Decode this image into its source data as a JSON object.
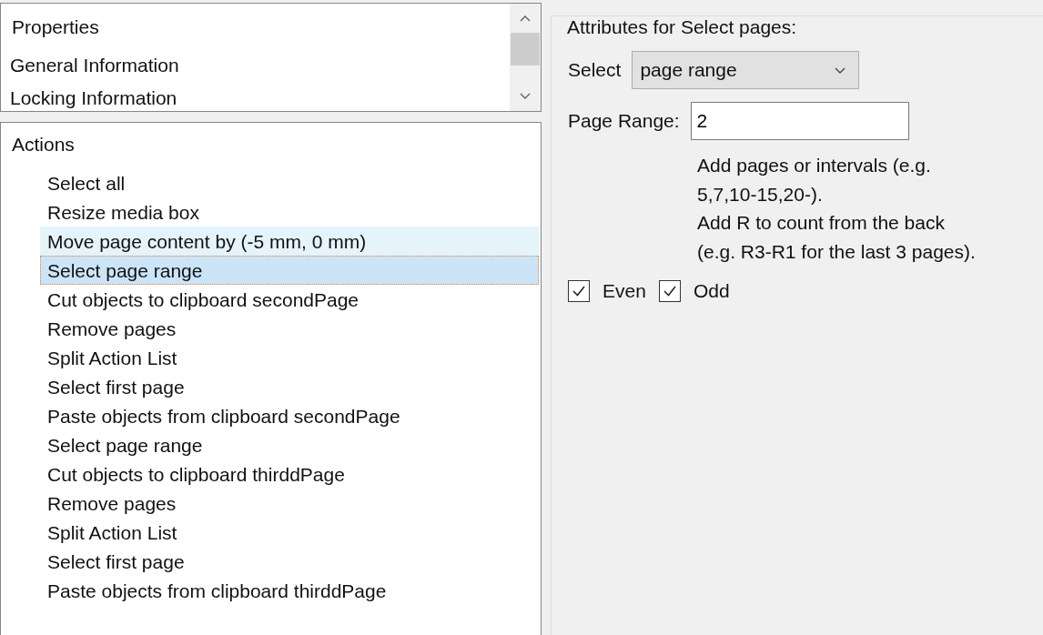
{
  "properties_list": {
    "header": "Properties",
    "items": [
      "General Information",
      "Locking Information"
    ]
  },
  "actions_list": {
    "header": "Actions",
    "items": [
      {
        "label": "Select all",
        "selected": false,
        "hovered": false
      },
      {
        "label": "Resize media box",
        "selected": false,
        "hovered": false
      },
      {
        "label": "Move page content by (-5 mm, 0 mm)",
        "selected": false,
        "hovered": true
      },
      {
        "label": "Select page range",
        "selected": true,
        "hovered": false
      },
      {
        "label": "Cut objects to clipboard secondPage",
        "selected": false,
        "hovered": false
      },
      {
        "label": "Remove pages",
        "selected": false,
        "hovered": false
      },
      {
        "label": "Split Action List",
        "selected": false,
        "hovered": false
      },
      {
        "label": "Select first page",
        "selected": false,
        "hovered": false
      },
      {
        "label": "Paste objects from clipboard secondPage",
        "selected": false,
        "hovered": false
      },
      {
        "label": "Select page range",
        "selected": false,
        "hovered": false
      },
      {
        "label": "Cut objects to clipboard thirddPage",
        "selected": false,
        "hovered": false
      },
      {
        "label": "Remove pages",
        "selected": false,
        "hovered": false
      },
      {
        "label": "Split Action List",
        "selected": false,
        "hovered": false
      },
      {
        "label": "Select first page",
        "selected": false,
        "hovered": false
      },
      {
        "label": "Paste objects from clipboard thirddPage",
        "selected": false,
        "hovered": false
      }
    ]
  },
  "attributes": {
    "title": "Attributes for Select pages:",
    "select": {
      "label": "Select",
      "value": "page range"
    },
    "page_range": {
      "label": "Page Range:",
      "value": "2"
    },
    "help_lines": [
      "Add pages or intervals (e.g.",
      "5,7,10-15,20-).",
      "Add R to count from the back",
      "(e.g. R3-R1 for the last 3 pages)."
    ],
    "checkboxes": [
      {
        "label": "Even",
        "checked": true
      },
      {
        "label": "Odd",
        "checked": true
      }
    ]
  }
}
